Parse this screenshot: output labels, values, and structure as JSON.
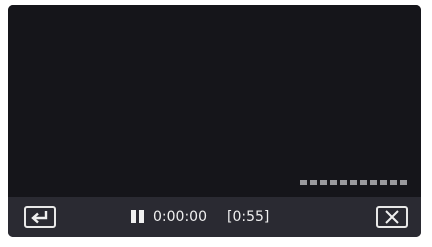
{
  "player": {
    "elapsed_time": "0:00:00",
    "remaining_time": "[0:55]",
    "state": "paused",
    "segment_count": 11
  },
  "icons": {
    "back": "return-arrow-icon",
    "pause": "pause-icon",
    "close": "close-x-icon"
  },
  "colors": {
    "screen_background": "#15151a",
    "control_bar": "#2a2a32",
    "foreground": "#f0f0f0",
    "segment": "#9a9a9e"
  }
}
